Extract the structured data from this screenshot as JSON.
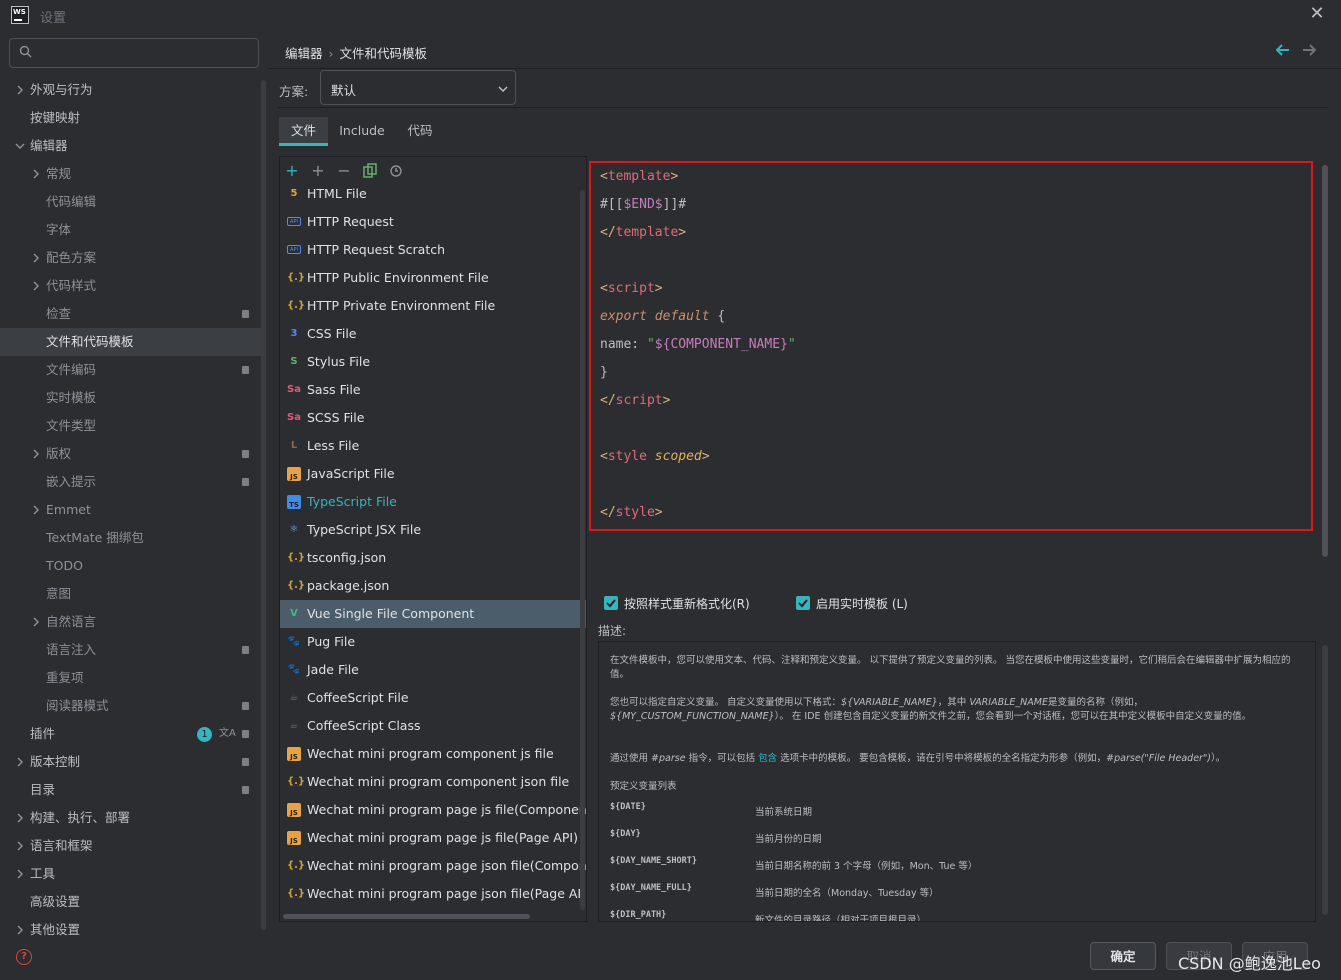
{
  "window": {
    "title": "设置"
  },
  "search": {
    "placeholder": ""
  },
  "sidebar": {
    "items": [
      {
        "label": "外观与行为",
        "indent": 0,
        "chevron": "right"
      },
      {
        "label": "按键映射",
        "indent": 0,
        "chevron": ""
      },
      {
        "label": "编辑器",
        "indent": 0,
        "chevron": "down"
      },
      {
        "label": "常规",
        "indent": 1,
        "chevron": "right"
      },
      {
        "label": "代码编辑",
        "indent": 2,
        "chevron": ""
      },
      {
        "label": "字体",
        "indent": 2,
        "chevron": ""
      },
      {
        "label": "配色方案",
        "indent": 1,
        "chevron": "right"
      },
      {
        "label": "代码样式",
        "indent": 1,
        "chevron": "right"
      },
      {
        "label": "检查",
        "indent": 2,
        "chevron": "",
        "badge": true
      },
      {
        "label": "文件和代码模板",
        "indent": 2,
        "chevron": "",
        "selected": true
      },
      {
        "label": "文件编码",
        "indent": 2,
        "chevron": "",
        "badge": true
      },
      {
        "label": "实时模板",
        "indent": 2,
        "chevron": ""
      },
      {
        "label": "文件类型",
        "indent": 2,
        "chevron": ""
      },
      {
        "label": "版权",
        "indent": 1,
        "chevron": "right",
        "badge": true
      },
      {
        "label": "嵌入提示",
        "indent": 2,
        "chevron": "",
        "badge": true
      },
      {
        "label": "Emmet",
        "indent": 1,
        "chevron": "right"
      },
      {
        "label": "TextMate 捆绑包",
        "indent": 2,
        "chevron": ""
      },
      {
        "label": "TODO",
        "indent": 2,
        "chevron": ""
      },
      {
        "label": "意图",
        "indent": 2,
        "chevron": ""
      },
      {
        "label": "自然语言",
        "indent": 1,
        "chevron": "right"
      },
      {
        "label": "语言注入",
        "indent": 2,
        "chevron": "",
        "badge": true
      },
      {
        "label": "重复项",
        "indent": 2,
        "chevron": ""
      },
      {
        "label": "阅读器模式",
        "indent": 2,
        "chevron": "",
        "badge": true
      },
      {
        "label": "插件",
        "indent": 0,
        "chevron": "",
        "badge": true,
        "count": "1"
      },
      {
        "label": "版本控制",
        "indent": 0,
        "chevron": "right",
        "badge": true
      },
      {
        "label": "目录",
        "indent": 0,
        "chevron": "",
        "badge": true
      },
      {
        "label": "构建、执行、部署",
        "indent": 0,
        "chevron": "right"
      },
      {
        "label": "语言和框架",
        "indent": 0,
        "chevron": "right"
      },
      {
        "label": "工具",
        "indent": 0,
        "chevron": "right"
      },
      {
        "label": "高级设置",
        "indent": 0,
        "chevron": ""
      },
      {
        "label": "其他设置",
        "indent": 0,
        "chevron": "right"
      }
    ]
  },
  "breadcrumb": {
    "part1": "编辑器",
    "separator": "›",
    "part2": "文件和代码模板"
  },
  "scheme": {
    "label": "方案:",
    "value": "默认"
  },
  "tabs": [
    {
      "label": "文件",
      "active": true
    },
    {
      "label": "Include",
      "active": false
    },
    {
      "label": "代码",
      "active": false
    }
  ],
  "templates": [
    {
      "label": "HTML File",
      "icon": "html-icon",
      "color": "#e8a33d",
      "glyph": "5"
    },
    {
      "label": "HTTP Request",
      "icon": "api-icon",
      "color": "#548af7",
      "glyph": "API"
    },
    {
      "label": "HTTP Request Scratch",
      "icon": "api-icon",
      "color": "#548af7",
      "glyph": "API"
    },
    {
      "label": "HTTP Public Environment File",
      "icon": "json-icon",
      "color": "#c7a43b",
      "glyph": "{.}"
    },
    {
      "label": "HTTP Private Environment File",
      "icon": "json-icon",
      "color": "#c7a43b",
      "glyph": "{.}"
    },
    {
      "label": "CSS File",
      "icon": "css-icon",
      "color": "#548af7",
      "glyph": "3"
    },
    {
      "label": "Stylus File",
      "icon": "stylus-icon",
      "color": "#6aab73",
      "glyph": "S"
    },
    {
      "label": "Sass File",
      "icon": "sass-icon",
      "color": "#db5c7e",
      "glyph": "Sa"
    },
    {
      "label": "SCSS File",
      "icon": "sass-icon",
      "color": "#db5c7e",
      "glyph": "Sa"
    },
    {
      "label": "Less File",
      "icon": "less-icon",
      "color": "#8a6552",
      "glyph": "L"
    },
    {
      "label": "JavaScript File",
      "icon": "js-icon",
      "color": "#e8a33d",
      "glyph": "JS"
    },
    {
      "label": "TypeScript File",
      "icon": "ts-icon",
      "color": "#3d8ee8",
      "glyph": "TS",
      "link": true
    },
    {
      "label": "TypeScript JSX File",
      "icon": "react-icon",
      "color": "#6fbfe8",
      "glyph": "⚛"
    },
    {
      "label": "tsconfig.json",
      "icon": "json-icon",
      "color": "#c7a43b",
      "glyph": "{.}"
    },
    {
      "label": "package.json",
      "icon": "json-icon",
      "color": "#c7a43b",
      "glyph": "{.}"
    },
    {
      "label": "Vue Single File Component",
      "icon": "vue-icon",
      "color": "#41b883",
      "glyph": "V",
      "selected": true
    },
    {
      "label": "Pug File",
      "icon": "pug-icon",
      "color": "#d9a347",
      "glyph": "🐾"
    },
    {
      "label": "Jade File",
      "icon": "pug-icon",
      "color": "#d9a347",
      "glyph": "🐾"
    },
    {
      "label": "CoffeeScript File",
      "icon": "coffee-icon",
      "color": "#8a6552",
      "glyph": "☕"
    },
    {
      "label": "CoffeeScript Class",
      "icon": "coffee-icon",
      "color": "#8a6552",
      "glyph": "☕"
    },
    {
      "label": "Wechat mini program component js file",
      "icon": "js-icon",
      "color": "#e8a33d",
      "glyph": "JS"
    },
    {
      "label": "Wechat mini program component json file",
      "icon": "json-icon",
      "color": "#c7a43b",
      "glyph": "{.}"
    },
    {
      "label": "Wechat mini program page js file(Component API)",
      "icon": "js-icon",
      "color": "#e8a33d",
      "glyph": "JS"
    },
    {
      "label": "Wechat mini program page js file(Page API)",
      "icon": "js-icon",
      "color": "#e8a33d",
      "glyph": "JS"
    },
    {
      "label": "Wechat mini program page json file(Component API)",
      "icon": "json-icon",
      "color": "#c7a43b",
      "glyph": "{.}"
    },
    {
      "label": "Wechat mini program page json file(Page API)",
      "icon": "json-icon",
      "color": "#c7a43b",
      "glyph": "{.}"
    }
  ],
  "code": {
    "l1": {
      "open": "<",
      "name": "template",
      "close": ">"
    },
    "l2": {
      "pre": "#[[",
      "var": "$END$",
      "post": "]]#"
    },
    "l3": {
      "open": "</",
      "name": "template",
      "close": ">"
    },
    "l5": {
      "open": "<",
      "name": "script",
      "close": ">"
    },
    "l6": {
      "kw": "export default",
      "rest": " {"
    },
    "l7": {
      "key": "name: ",
      "str1": "\"",
      "var": "${COMPONENT_NAME}",
      "str2": "\""
    },
    "l8": {
      "text": "}"
    },
    "l9": {
      "open": "</",
      "name": "script",
      "close": ">"
    },
    "l11": {
      "open": "<",
      "name": "style",
      "attr": "scoped",
      "close": ">"
    },
    "l13": {
      "open": "</",
      "name": "style",
      "close": ">"
    }
  },
  "options": {
    "reformat": "按照样式重新格式化(R)",
    "live_templates": "启用实时模板 (L)"
  },
  "description": {
    "label": "描述:",
    "p1": "在文件模板中，您可以使用文本、代码、注释和预定义变量。 以下提供了预定义变量的列表。 当您在模板中使用这些变量时，它们稍后会在编辑器中扩展为相应的值。",
    "p2a": "您也可以指定自定义变量。 自定义变量使用以下格式：",
    "p2b": "${VARIABLE_NAME}",
    "p2c": "，其中 ",
    "p2d": "VARIABLE_NAME",
    "p2e": "是变量的名称（例如，",
    "p2f": "${MY_CUSTOM_FUNCTION_NAME}",
    "p2g": "）。 在 IDE 创建包含自定义变量的新文件之前，您会看到一个对话框，您可以在其中定义模板中自定义变量的值。",
    "p3a": "通过使用 ",
    "p3b": "#parse",
    "p3c": " 指令，可以包括 ",
    "p3d": "包含",
    "p3e": " 选项卡中的模板。 要包含模板，请在引号中将模板的全名指定为形参（例如，",
    "p3f": "#parse(\"File Header\")",
    "p3g": "）。",
    "vars_title": "预定义变量列表",
    "vars": [
      {
        "name": "${DATE}",
        "desc": "当前系统日期"
      },
      {
        "name": "${DAY}",
        "desc": "当前月份的日期"
      },
      {
        "name": "${DAY_NAME_SHORT}",
        "desc": "当前日期名称的前 3 个字母（例如，Mon、Tue 等）"
      },
      {
        "name": "${DAY_NAME_FULL}",
        "desc": "当前日期的全名（Monday、Tuesday 等）"
      },
      {
        "name": "${DIR_PATH}",
        "desc": "新文件的目录路径（相对于项目根目录）"
      }
    ]
  },
  "buttons": {
    "ok": "确定",
    "cancel": "取消",
    "apply": "应用"
  },
  "watermark": "CSDN @鲍逸池Leo",
  "colors": {
    "accent": "#35b5bf",
    "highlight_border": "#e3131b",
    "selection": "#4b5d6b"
  }
}
